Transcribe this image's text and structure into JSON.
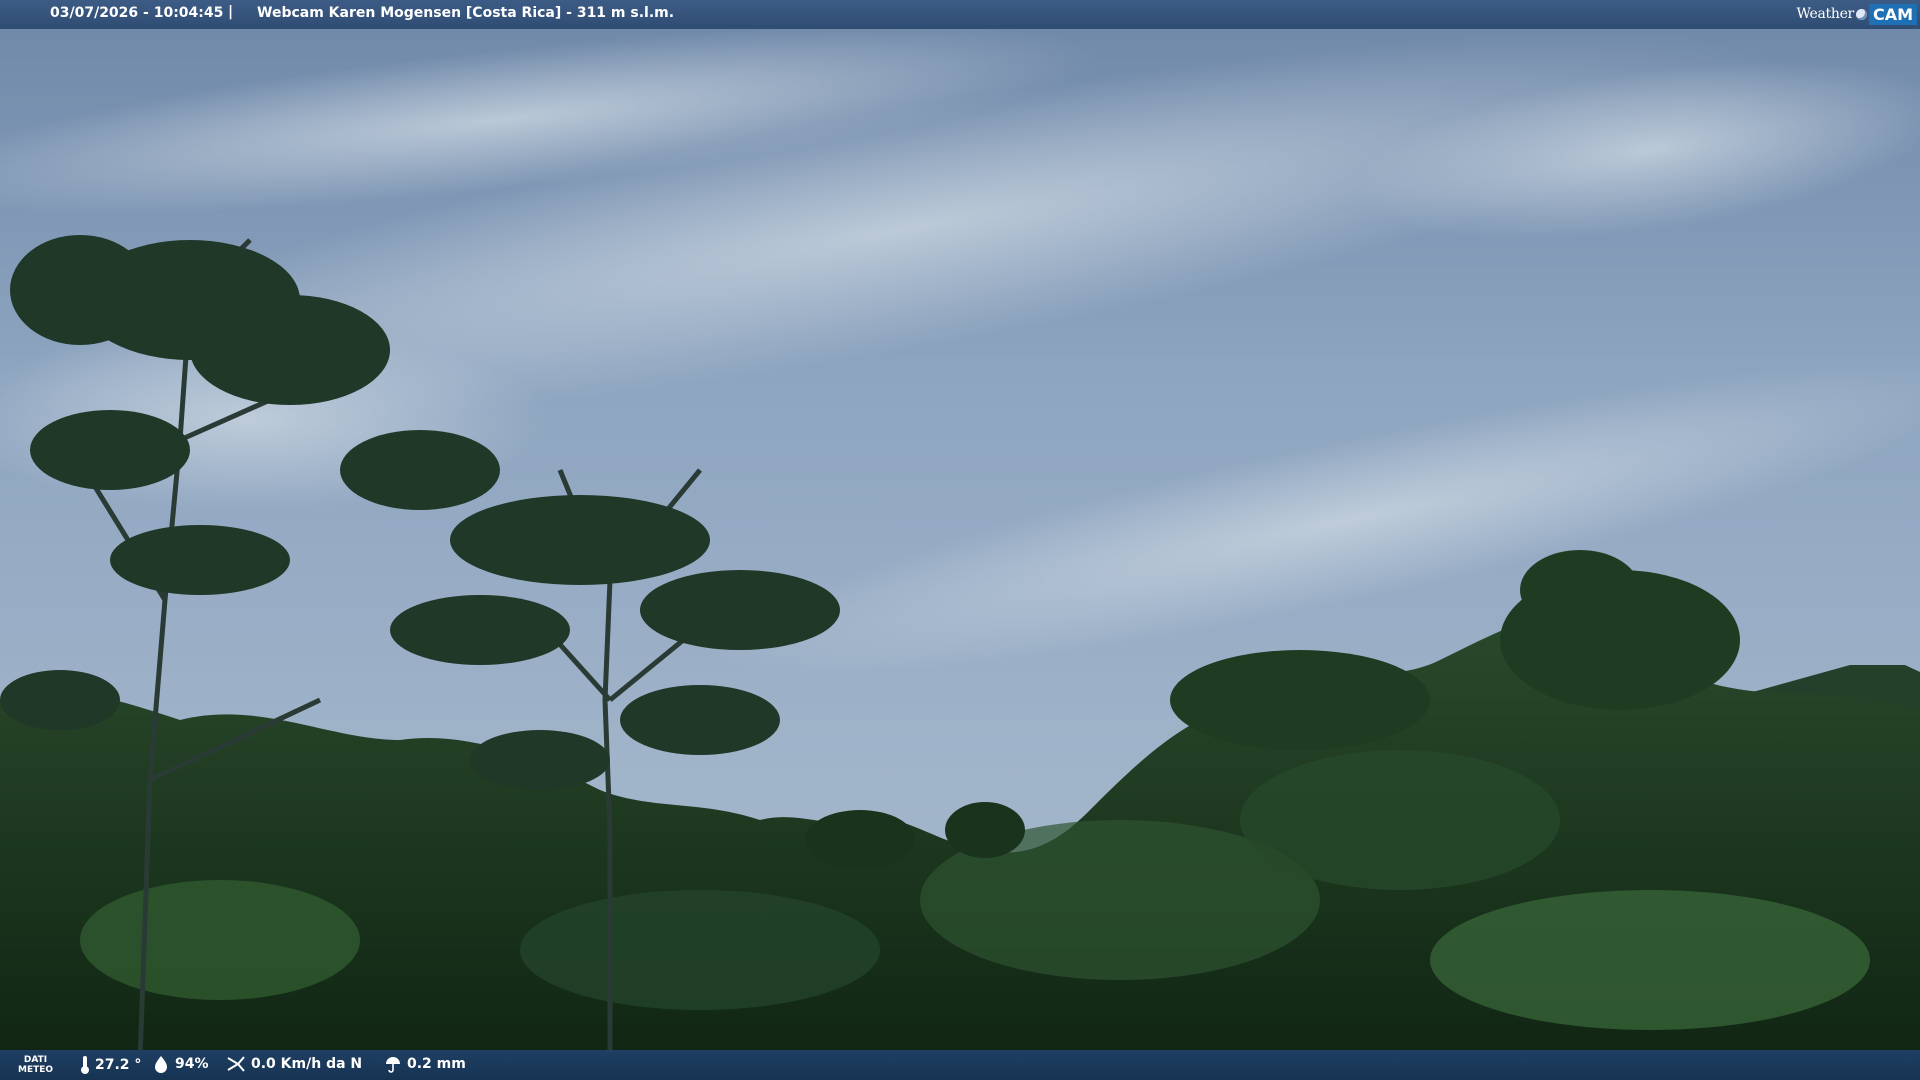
{
  "header": {
    "timestamp": "03/07/2026 - 10:04:45",
    "separator": "|",
    "title": "Webcam Karen Mogensen [Costa Rica]  - 311 m s.l.m."
  },
  "brand": {
    "word": "Weather",
    "badge": "CAM"
  },
  "footer": {
    "label_line1": "DATI",
    "label_line2": "METEO",
    "temperature": "27.2 °",
    "humidity": "94%",
    "wind": "0.0 Km/h da N",
    "rain": "0.2 mm",
    "icons": [
      "thermometer-icon",
      "humidity-icon",
      "wind-icon",
      "rain-icon"
    ]
  },
  "colors": {
    "sky": "#8ea5c0",
    "foliage": "#1d3a1f",
    "bar": "#2f4c73",
    "badge": "#1f6fb5"
  }
}
